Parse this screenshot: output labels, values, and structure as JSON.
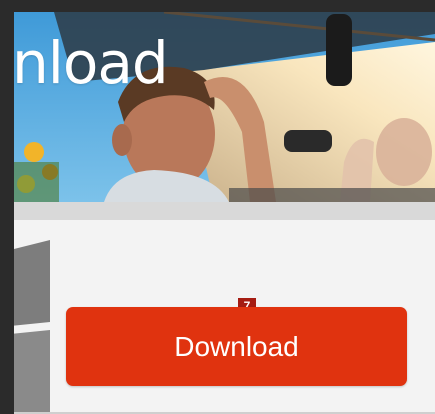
{
  "hero": {
    "title": "nload"
  },
  "download_button": {
    "label": "Download"
  },
  "badge": {
    "number": "7"
  },
  "colors": {
    "accent": "#e0330f",
    "badge": "#a51c12",
    "hero_sky": "#4aa3dc"
  },
  "icons": {
    "windows_logo": "windows-logo-icon"
  }
}
